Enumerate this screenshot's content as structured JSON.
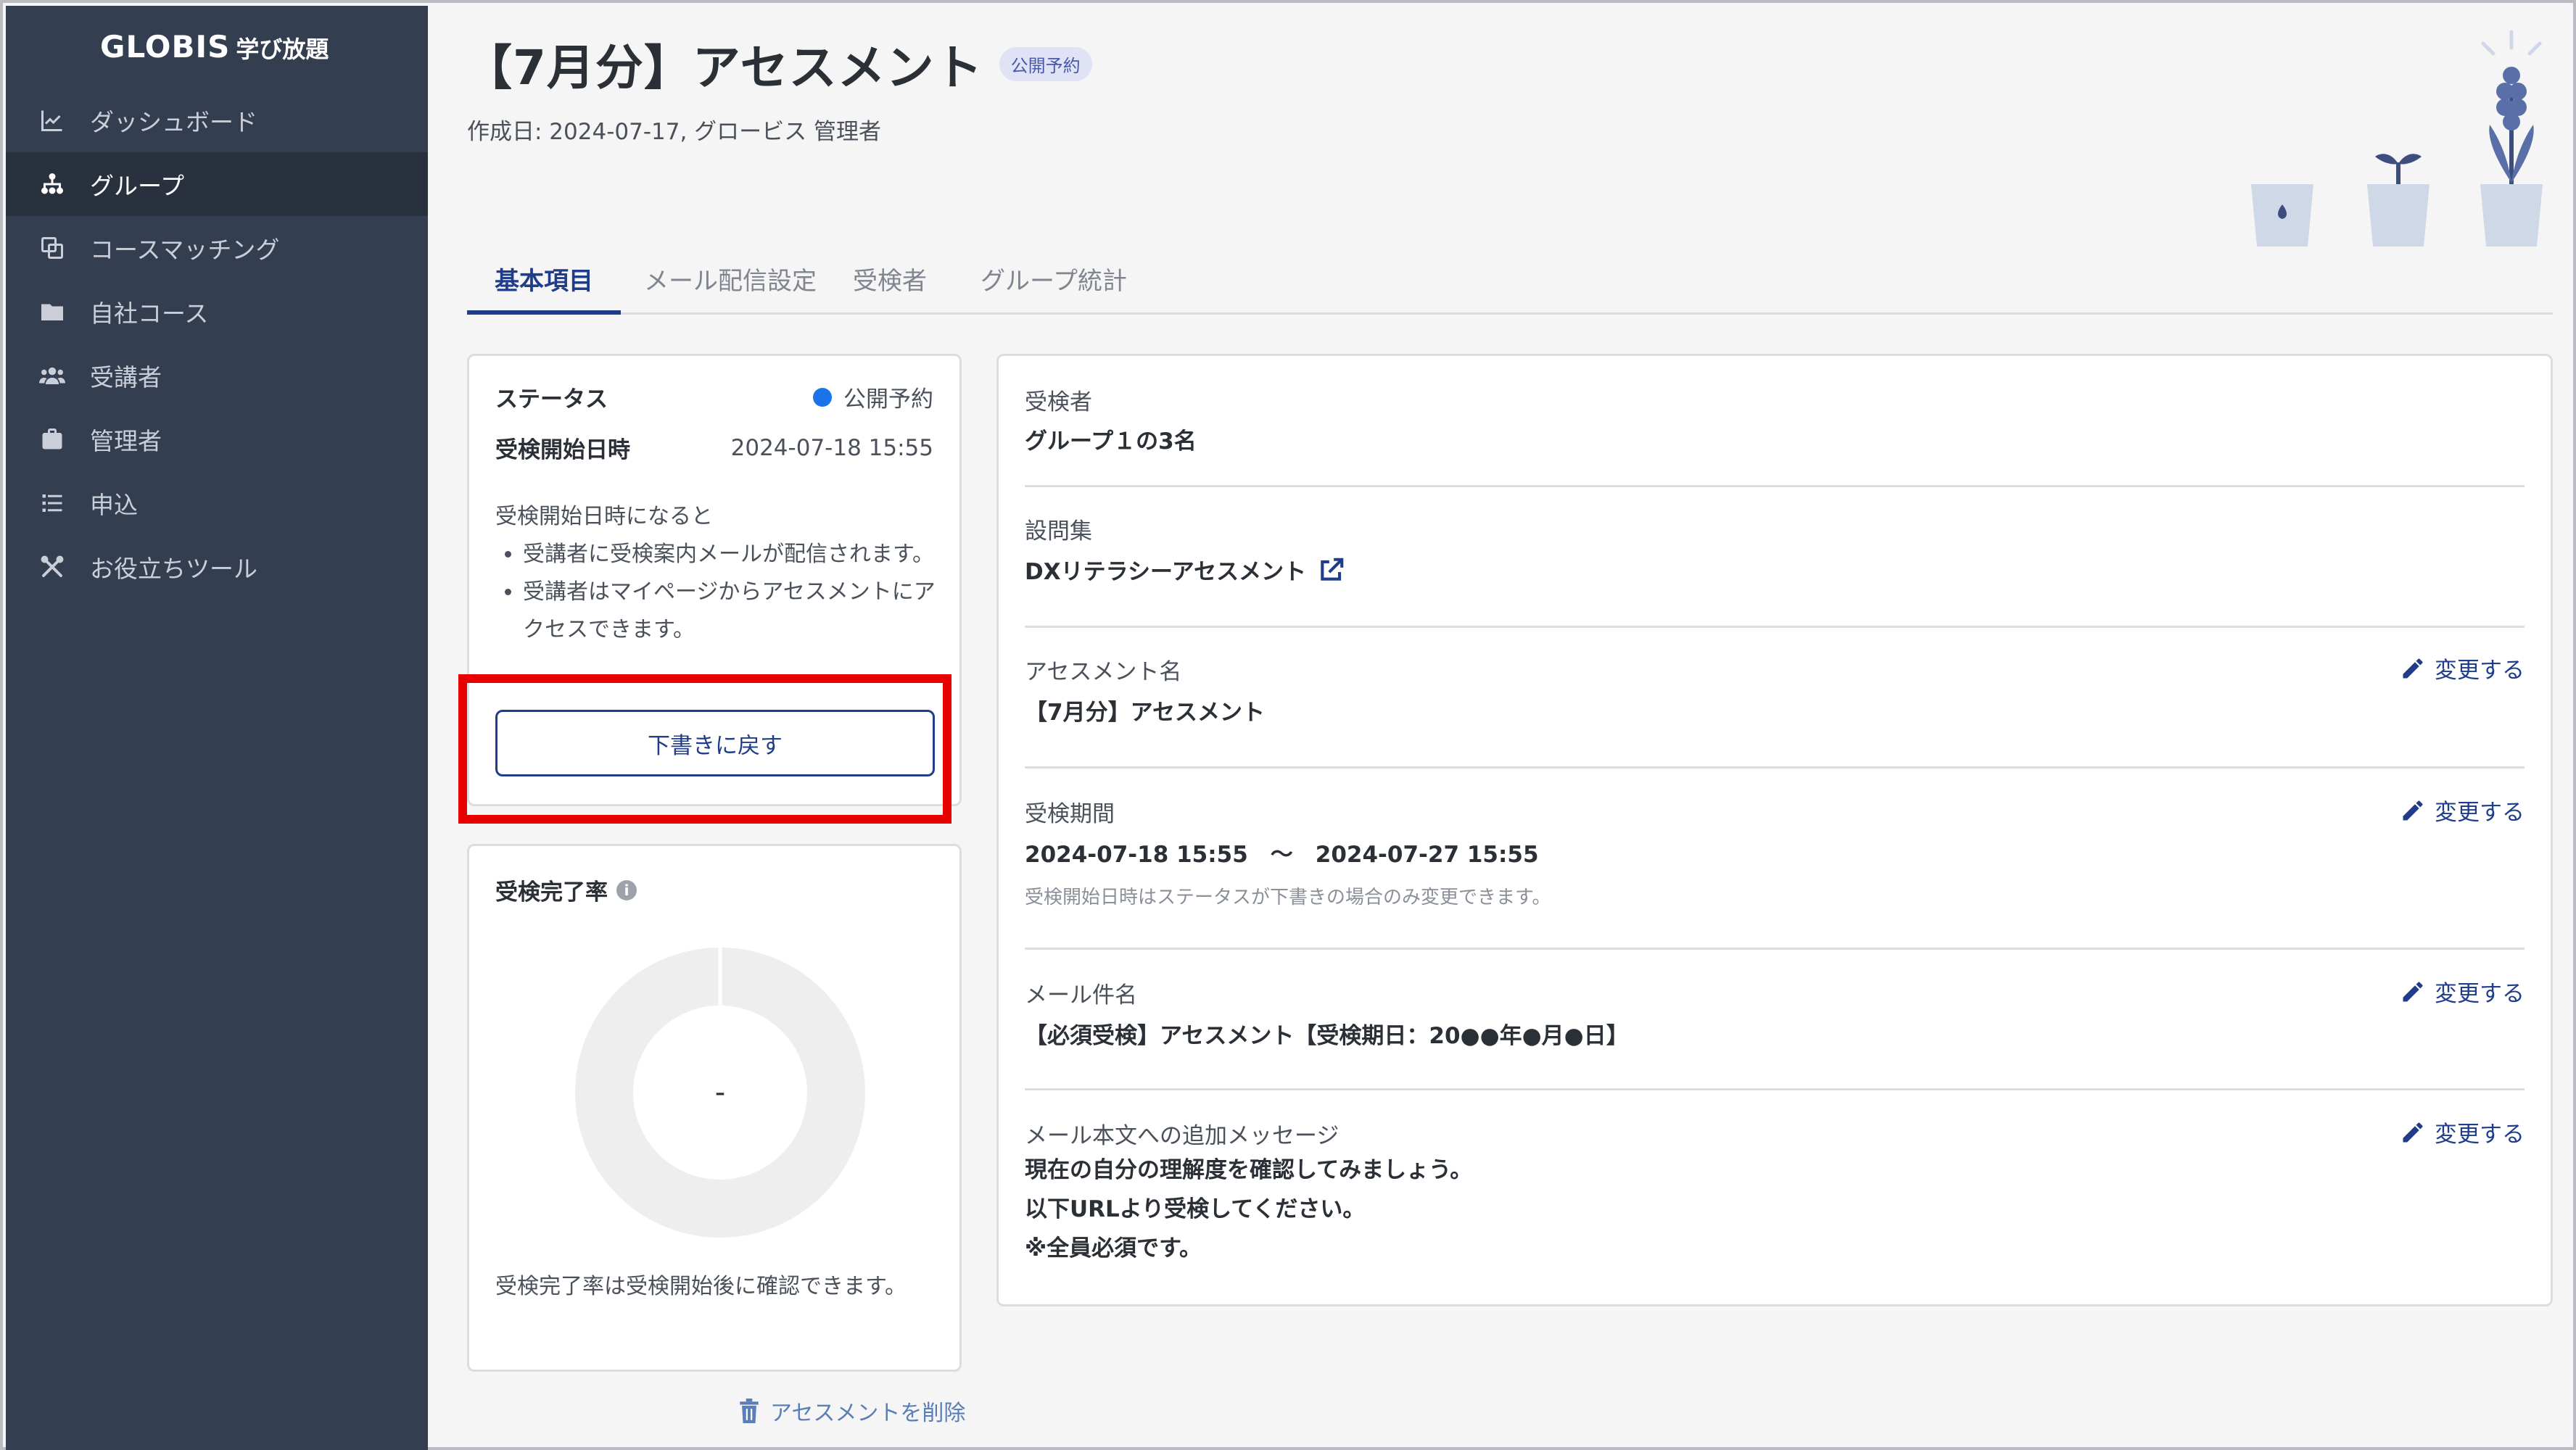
{
  "brand": {
    "logo": "GLOBIS",
    "product": "学び放題"
  },
  "sidebar": {
    "items": [
      {
        "label": "ダッシュボード",
        "icon": "chart-line-icon",
        "active": false
      },
      {
        "label": "グループ",
        "icon": "sitemap-icon",
        "active": true
      },
      {
        "label": "コースマッチング",
        "icon": "copy-icon",
        "active": false
      },
      {
        "label": "自社コース",
        "icon": "folder-icon",
        "active": false
      },
      {
        "label": "受講者",
        "icon": "users-icon",
        "active": false
      },
      {
        "label": "管理者",
        "icon": "briefcase-icon",
        "active": false
      },
      {
        "label": "申込",
        "icon": "list-icon",
        "active": false
      },
      {
        "label": "お役立ちツール",
        "icon": "tools-icon",
        "active": false
      }
    ]
  },
  "header": {
    "title": "【7月分】アセスメント",
    "badge": "公開予約",
    "meta": "作成日: 2024-07-17, グロービス 管理者"
  },
  "tabs": [
    "基本項目",
    "メール配信設定",
    "受検者",
    "グループ統計"
  ],
  "status_card": {
    "status_label": "ステータス",
    "status_value": "公開予約",
    "status_color": "#1a73e8",
    "start_label": "受検開始日時",
    "start_value": "2024-07-18 15:55",
    "note_intro": "受検開始日時になると",
    "note_items": [
      "受講者に受検案内メールが配信されます。",
      "受講者はマイページからアセスメントにアクセスできます。"
    ],
    "draft_button": "下書きに戻す"
  },
  "rate_card": {
    "title": "受検完了率",
    "value": "-",
    "note": "受検完了率は受検開始後に確認できます。"
  },
  "delete_link": "アセスメントを削除",
  "details": {
    "examinees_label": "受検者",
    "examinees_value": "グループ１の3名",
    "questionset_label": "設問集",
    "questionset_value": "DXリテラシーアセスメント",
    "name_label": "アセスメント名",
    "name_value": "【7月分】アセスメント",
    "period_label": "受検期間",
    "period_value": "2024-07-18 15:55　〜　2024-07-27 15:55",
    "period_note": "受検開始日時はステータスが下書きの場合のみ変更できます。",
    "subject_label": "メール件名",
    "subject_value": "【必須受検】アセスメント【受検期日：20●●年●月●日】",
    "message_label": "メール本文への追加メッセージ",
    "message_lines": [
      "現在の自分の理解度を確認してみましょう。",
      "以下URLより受検してください。",
      "※全員必須です。"
    ],
    "edit_label": "変更する"
  },
  "colors": {
    "sidebar_bg": "#343e51",
    "accent": "#1f3d8a",
    "highlight": "#e60000"
  }
}
